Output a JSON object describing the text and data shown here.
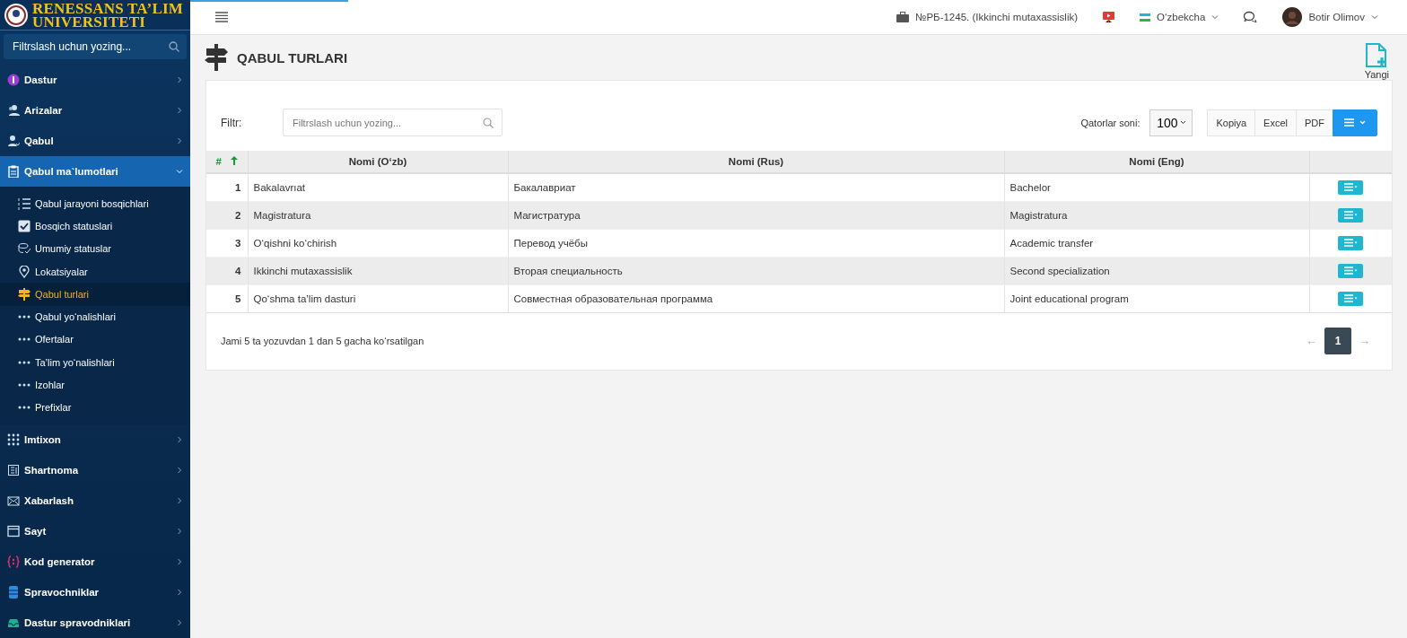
{
  "loading_bar": {
    "level": 0.13
  },
  "brand": {
    "line1": "RENESSANS TA’LIM",
    "line2": "UNIVERSITETI"
  },
  "sidebar": {
    "search": {
      "placeholder": "Filtrslash uchun yozing..."
    },
    "items": [
      {
        "label": "Dastur",
        "expanded": false,
        "selected": false
      },
      {
        "label": "Arizalar",
        "expanded": false,
        "selected": false
      },
      {
        "label": "Qabul",
        "expanded": false,
        "selected": false
      },
      {
        "label": "Qabul ma`lumotlari",
        "expanded": true,
        "selected": true,
        "children": [
          {
            "label": "Qabul jarayoni bosqichlari",
            "selected": false
          },
          {
            "label": "Bosqich statuslari",
            "selected": false
          },
          {
            "label": "Umumiy statuslar",
            "selected": false
          },
          {
            "label": "Lokatsiyalar",
            "selected": false
          },
          {
            "label": "Qabul turlari",
            "selected": true
          },
          {
            "label": "Qabul yo‘nalishlari",
            "selected": false
          },
          {
            "label": "Ofertalar",
            "selected": false
          },
          {
            "label": "Ta’lim yo‘nalishlari",
            "selected": false
          },
          {
            "label": "Izohlar",
            "selected": false
          },
          {
            "label": "Prefixlar",
            "selected": false
          }
        ]
      },
      {
        "label": "Imtixon",
        "expanded": false,
        "selected": false
      },
      {
        "label": "Shartnoma",
        "expanded": false,
        "selected": false
      },
      {
        "label": "Xabarlash",
        "expanded": false,
        "selected": false
      },
      {
        "label": "Sayt",
        "expanded": false,
        "selected": false
      },
      {
        "label": "Kod generator",
        "expanded": false,
        "selected": false
      },
      {
        "label": "Spravochniklar",
        "expanded": false,
        "selected": false
      },
      {
        "label": "Dastur spravodniklari",
        "expanded": false,
        "selected": false
      }
    ]
  },
  "topbar": {
    "role": "№РБ-1245. (Ikkinchi mutaxassislik)",
    "language": "O‘zbekcha",
    "user": "Botir Olimov"
  },
  "page": {
    "title": "QABUL TURLARI",
    "new_button": "Yangi"
  },
  "toolbar": {
    "filter_label": "Filtr:",
    "filter": {
      "placeholder": "Filtrslash uchun yozing..."
    },
    "rows_label": "Qatorlar soni:",
    "rows_value": "100",
    "buttons": [
      "Kopiya",
      "Excel",
      "PDF"
    ]
  },
  "table": {
    "columns": [
      "#",
      "Nomi (O‘zb)",
      "Nomi (Rus)",
      "Nomi (Eng)"
    ],
    "rows": [
      [
        "1",
        "Bakalavrıat",
        "Бакалавриат",
        "Bachelor"
      ],
      [
        "2",
        "Magistratura",
        "Магистратура",
        "Magistratura"
      ],
      [
        "3",
        "O‘qishni ko‘chirish",
        "Перевод учёбы",
        "Academic transfer"
      ],
      [
        "4",
        "Ikkinchi mutaxassislik",
        "Вторая специальность",
        "Second specialization"
      ],
      [
        "5",
        "Qo‘shma ta’lim dasturi",
        "Совместная образовательная программа",
        "Joint educational program"
      ]
    ]
  },
  "footer": {
    "summary": "Jami 5 ta yozuvdan 1 dan 5 gacha ko‘rsatilgan",
    "pagination": {
      "prev": "←",
      "pages": [
        {
          "label": "1",
          "selected": true
        }
      ],
      "next": "→"
    }
  }
}
